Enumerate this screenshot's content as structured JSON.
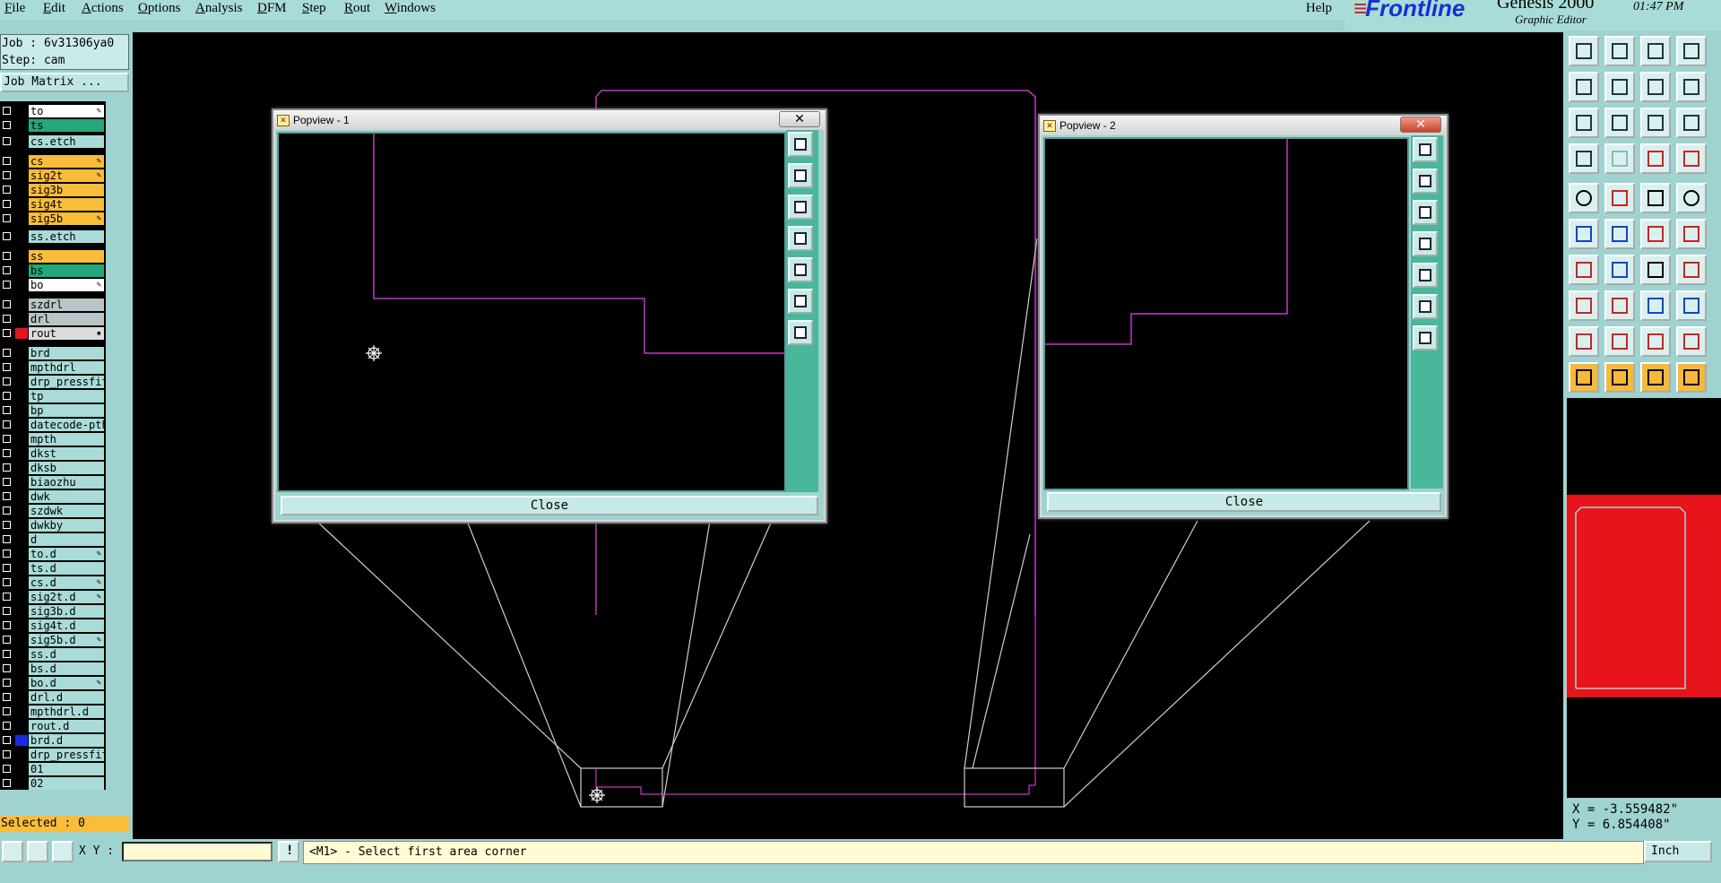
{
  "menu": {
    "items": [
      "File",
      "Edit",
      "Actions",
      "Options",
      "Analysis",
      "DFM",
      "Step",
      "Rout",
      "Windows"
    ],
    "help": "Help"
  },
  "brand": {
    "logo": "Frontline",
    "product": "Genesis 2000",
    "subtitle": "Graphic Editor",
    "clock": "01:47 PM"
  },
  "job": {
    "job_line": "Job : 6v31306ya0",
    "step_line": "Step: cam",
    "matrix_button": "Job Matrix ..."
  },
  "layers": [
    {
      "name": "to",
      "color": "#ffffff",
      "flag": "✎"
    },
    {
      "name": "ts",
      "color": "#22a87a",
      "flag": ""
    },
    {
      "name": "cs.etch",
      "color": "#a9dcd8",
      "flag": ""
    },
    {
      "name": "cs",
      "color": "#f9bd3a",
      "flag": "✎"
    },
    {
      "name": "sig2t",
      "color": "#f9bd3a",
      "flag": "✎"
    },
    {
      "name": "sig3b",
      "color": "#f9bd3a",
      "flag": ""
    },
    {
      "name": "sig4t",
      "color": "#f9bd3a",
      "flag": ""
    },
    {
      "name": "sig5b",
      "color": "#f9bd3a",
      "flag": "✎"
    },
    {
      "name": "ss.etch",
      "color": "#a9dcd8",
      "flag": ""
    },
    {
      "name": "ss",
      "color": "#f9bd3a",
      "flag": ""
    },
    {
      "name": "bs",
      "color": "#22a87a",
      "flag": ""
    },
    {
      "name": "bo",
      "color": "#ffffff",
      "flag": "✎"
    },
    {
      "name": "szdrl",
      "color": "#b8c4c8",
      "flag": ""
    },
    {
      "name": "drl",
      "color": "#b8c4c8",
      "flag": ""
    },
    {
      "name": "rout",
      "color": "#dcdcdc",
      "flag": "▪",
      "swatch": "#e7141b",
      "active": true
    },
    {
      "name": "brd",
      "color": "#a9dcd8",
      "flag": ""
    },
    {
      "name": "mpthdrl",
      "color": "#a9dcd8",
      "flag": ""
    },
    {
      "name": "drp_pressfit",
      "color": "#a9dcd8",
      "flag": ""
    },
    {
      "name": "tp",
      "color": "#a9dcd8",
      "flag": ""
    },
    {
      "name": "bp",
      "color": "#a9dcd8",
      "flag": ""
    },
    {
      "name": "datecode-pth",
      "color": "#a9dcd8",
      "flag": ""
    },
    {
      "name": "mpth",
      "color": "#a9dcd8",
      "flag": ""
    },
    {
      "name": "dkst",
      "color": "#a9dcd8",
      "flag": ""
    },
    {
      "name": "dksb",
      "color": "#a9dcd8",
      "flag": ""
    },
    {
      "name": "biaozhu",
      "color": "#a9dcd8",
      "flag": ""
    },
    {
      "name": "dwk",
      "color": "#a9dcd8",
      "flag": ""
    },
    {
      "name": "szdwk",
      "color": "#a9dcd8",
      "flag": ""
    },
    {
      "name": "dwkby",
      "color": "#a9dcd8",
      "flag": ""
    },
    {
      "name": "d",
      "color": "#a9dcd8",
      "flag": ""
    },
    {
      "name": "to.d",
      "color": "#a9dcd8",
      "flag": "✎"
    },
    {
      "name": "ts.d",
      "color": "#a9dcd8",
      "flag": ""
    },
    {
      "name": "cs.d",
      "color": "#a9dcd8",
      "flag": "✎"
    },
    {
      "name": "sig2t.d",
      "color": "#a9dcd8",
      "flag": "✎"
    },
    {
      "name": "sig3b.d",
      "color": "#a9dcd8",
      "flag": ""
    },
    {
      "name": "sig4t.d",
      "color": "#a9dcd8",
      "flag": ""
    },
    {
      "name": "sig5b.d",
      "color": "#a9dcd8",
      "flag": "✎"
    },
    {
      "name": "ss.d",
      "color": "#a9dcd8",
      "flag": ""
    },
    {
      "name": "bs.d",
      "color": "#a9dcd8",
      "flag": ""
    },
    {
      "name": "bo.d",
      "color": "#a9dcd8",
      "flag": "✎"
    },
    {
      "name": "drl.d",
      "color": "#a9dcd8",
      "flag": ""
    },
    {
      "name": "mpthdrl.d",
      "color": "#a9dcd8",
      "flag": ""
    },
    {
      "name": "rout.d",
      "color": "#a9dcd8",
      "flag": ""
    },
    {
      "name": "brd.d",
      "color": "#a9dcd8",
      "flag": "",
      "swatch": "#1a2ae0"
    },
    {
      "name": "drp_pressfit",
      "color": "#a9dcd8",
      "flag": ""
    },
    {
      "name": "01",
      "color": "#a9dcd8",
      "flag": ""
    },
    {
      "name": "02",
      "color": "#a9dcd8",
      "flag": ""
    }
  ],
  "selected": "Selected : 0",
  "popups": [
    {
      "title": "Popview - 1",
      "close_label": "Close",
      "close_glyph": "✕"
    },
    {
      "title": "Popview - 2",
      "close_label": "Close",
      "close_glyph": "✕"
    }
  ],
  "coords": {
    "x": "X = -3.559482\"",
    "y": "Y = 6.854408\""
  },
  "bottom": {
    "xy_label": "X Y :",
    "xy_value": "",
    "status": "<M1> - Select first area corner",
    "unit": "Inch"
  },
  "colors": {
    "teal": "#9fd3d0",
    "profile": "#c03cc0",
    "overview": "#e7141b",
    "layer_orange": "#f9bd3a",
    "layer_green": "#22a87a"
  }
}
